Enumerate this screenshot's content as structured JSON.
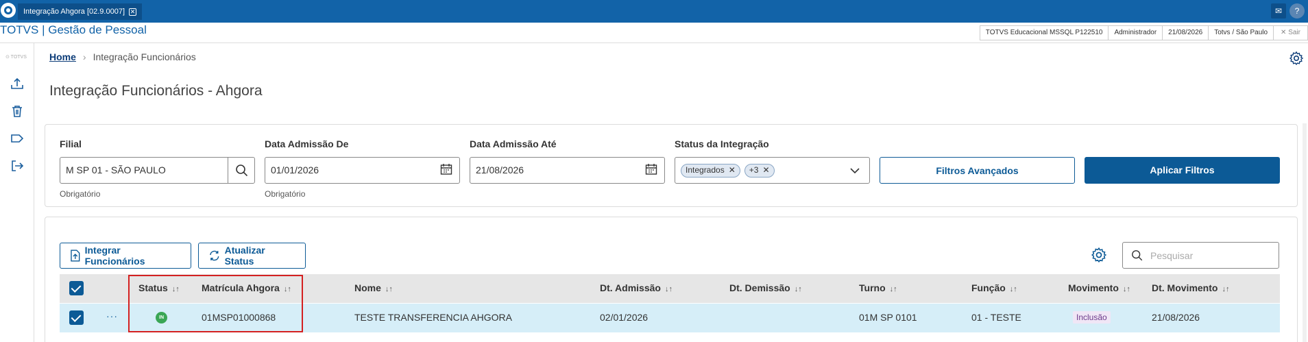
{
  "window": {
    "tab_title": "Integração Ahgora [02.9.0007]",
    "tab_close": "✕",
    "mail_icon": "mail-icon",
    "help_icon": "help-icon"
  },
  "module": {
    "title": "TOTVS | Gestão de Pessoal",
    "info": [
      "TOTVS Educacional MSSQL P122510",
      "Administrador",
      "21/08/2026",
      "Totvs / São Paulo"
    ],
    "exit_label": "✕  Sair"
  },
  "sidebar": {
    "brand": "⊙ TOTVS",
    "icons": [
      "upload-icon",
      "trash-icon",
      "tag-icon",
      "logout-icon"
    ]
  },
  "breadcrumb": {
    "home": "Home",
    "separator": "›",
    "current": "Integração Funcionários"
  },
  "page_title": "Integração Funcionários - Ahgora",
  "filters": {
    "filial": {
      "label": "Filial",
      "value": "M SP 01 - SÃO PAULO",
      "help": "Obrigatório"
    },
    "data_de": {
      "label": "Data Admissão De",
      "value": "01/01/2026",
      "help": "Obrigatório"
    },
    "data_ate": {
      "label": "Data Admissão Até",
      "value": "21/08/2026"
    },
    "status": {
      "label": "Status da Integração",
      "chips": [
        "Integrados",
        "+3"
      ]
    },
    "advanced_label": "Filtros Avançados",
    "apply_label": "Aplicar Filtros"
  },
  "actions": {
    "integrate_label": "Integrar Funcionários",
    "refresh_label": "Atualizar Status",
    "search_placeholder": "Pesquisar"
  },
  "table": {
    "headers": {
      "status": "Status",
      "matricula": "Matrícula Ahgora",
      "nome": "Nome",
      "dt_admissao": "Dt. Admissão",
      "dt_demissao": "Dt. Demissão",
      "turno": "Turno",
      "funcao": "Função",
      "movimento": "Movimento",
      "dt_movimento": "Dt. Movimento"
    },
    "sort_glyph": "↓↑",
    "rows": [
      {
        "status": "IN",
        "more": "···",
        "matricula": "01MSP01000868",
        "nome": "TESTE TRANSFERENCIA AHGORA",
        "dt_admissao": "02/01/2026",
        "dt_demissao": "",
        "turno": "01M SP 0101",
        "funcao": "01 - TESTE",
        "movimento": "Inclusão",
        "dt_movimento": "21/08/2026"
      }
    ]
  },
  "colors": {
    "primary": "#0c5a96",
    "titlebar": "#1263a8",
    "row_selected": "#d6eef8",
    "status_ok": "#3aa655",
    "highlight": "#d42020"
  }
}
